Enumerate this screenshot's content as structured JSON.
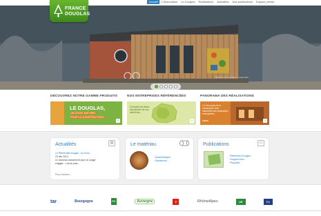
{
  "nav": {
    "items": [
      "Accueil",
      "L'Association",
      "Le Douglas",
      "Réalisations",
      "Actualités",
      "Nos publications",
      "Espace presse"
    ],
    "active_index": 0
  },
  "logo": {
    "line1": "FRANCE",
    "line2": "DOUGLAS"
  },
  "hero": {
    "credit": "Bâtiment bois Douglas - Fougerolles"
  },
  "sections": {
    "products": "DÉCOUVREZ NOTRE GAMME PRODUITS",
    "companies": "NOS ENTREPRISES RÉFÉRENCÉES",
    "panorama": "PANORAMA DES RÉALISATIONS"
  },
  "promos": {
    "products": {
      "title": "LE DOUGLAS,",
      "line1": "UN CHOIX NATUREL",
      "line2": "POUR LA CONSTRUCTION"
    },
    "companies": {
      "text": "Consultez les fiches descriptives de nos adhérents..."
    },
    "panorama": {
      "text": "Le Panorama de la construction bois rassemble des réalisations exemplaires...",
      "tag": "CNDB"
    },
    "go_label": "›"
  },
  "news": {
    "title": "Actualités",
    "line1": "Le Référentiel douglas : un choix...",
    "line2": "23 déc 2013",
    "line3": "Le nouveau classement pour un usage",
    "line4": "engagé... Lire la suite...",
    "more": "Plus d'articles..."
  },
  "material": {
    "title": "Le matériau",
    "links": [
      "· Caractéristique",
      "· Classement"
    ]
  },
  "publications": {
    "title": "Publications",
    "links": [
      "· Référentiel Douglas",
      "· Douglas Infos",
      "· Plaquette"
    ]
  },
  "partners": [
    "tar",
    "Bourgogne",
    "FC",
    "Auvergne",
    "F",
    "RhôneAlpes",
    "UE",
    "EU"
  ],
  "colors": {
    "accent": "#2e7fc2",
    "brand_green": "#6bb33b",
    "nav_active": "#2e7fc2"
  }
}
